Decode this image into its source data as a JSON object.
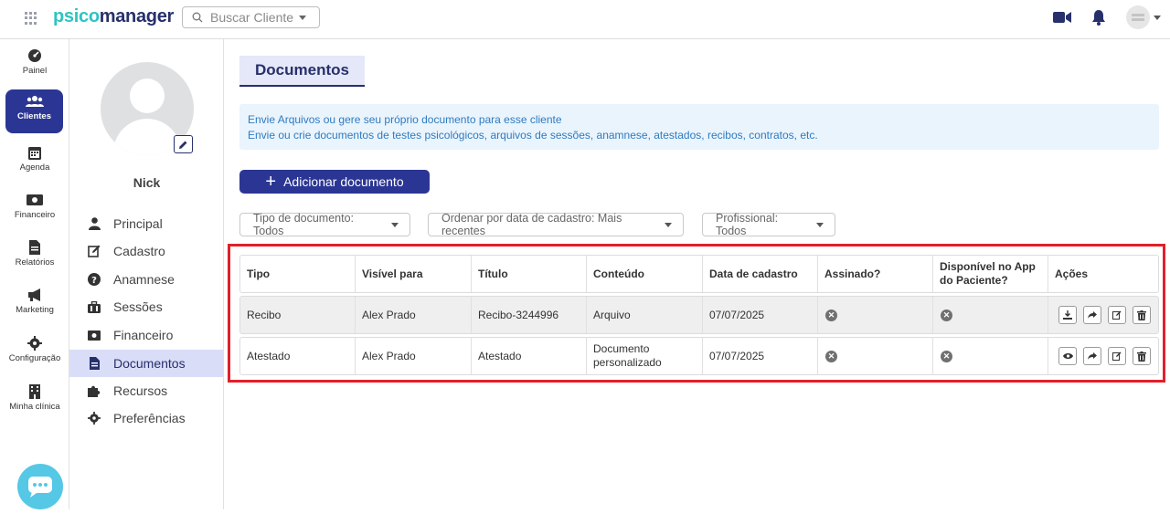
{
  "app": {
    "logo_prefix": "psico",
    "logo_suffix": "manager",
    "search_placeholder": "Buscar Cliente"
  },
  "rail": {
    "items": [
      {
        "label": "Painel",
        "icon": "dashboard-icon"
      },
      {
        "label": "Clientes",
        "icon": "users-icon",
        "active": true
      },
      {
        "label": "Agenda",
        "icon": "calendar-icon"
      },
      {
        "label": "Financeiro",
        "icon": "money-icon"
      },
      {
        "label": "Relatórios",
        "icon": "report-icon"
      },
      {
        "label": "Marketing",
        "icon": "megaphone-icon"
      },
      {
        "label": "Configuração",
        "icon": "gear-icon"
      },
      {
        "label": "Minha clínica",
        "icon": "building-icon"
      }
    ]
  },
  "profile": {
    "name": "Nick",
    "menu": [
      {
        "label": "Principal",
        "icon": "user-icon"
      },
      {
        "label": "Cadastro",
        "icon": "edit-icon"
      },
      {
        "label": "Anamnese",
        "icon": "question-icon"
      },
      {
        "label": "Sessões",
        "icon": "briefcase-icon"
      },
      {
        "label": "Financeiro",
        "icon": "money-icon"
      },
      {
        "label": "Documentos",
        "icon": "file-icon",
        "active": true
      },
      {
        "label": "Recursos",
        "icon": "puzzle-icon"
      },
      {
        "label": "Preferências",
        "icon": "gear-icon"
      }
    ]
  },
  "main": {
    "tab_title": "Documentos",
    "info_line1": "Envie Arquivos ou gere seu próprio documento para esse cliente",
    "info_line2": "Envie ou crie documentos de testes psicológicos, arquivos de sessões, anamnese, atestados, recibos, contratos, etc.",
    "add_button": "Adicionar documento",
    "filters": [
      "Tipo de documento: Todos",
      "Ordenar por data de cadastro: Mais recentes",
      "Profissional: Todos"
    ],
    "table": {
      "headers": [
        "Tipo",
        "Visível para",
        "Título",
        "Conteúdo",
        "Data de cadastro",
        "Assinado?",
        "Disponível no App do Paciente?",
        "Ações"
      ],
      "rows": [
        {
          "tipo": "Recibo",
          "visivel": "Alex Prado",
          "titulo": "Recibo-3244996",
          "conteudo": "Arquivo",
          "data": "07/07/2025"
        },
        {
          "tipo": "Atestado",
          "visivel": "Alex Prado",
          "titulo": "Atestado",
          "conteudo": "Documento personalizado",
          "data": "07/07/2025"
        }
      ]
    }
  },
  "colors": {
    "primary": "#2b3694",
    "accent": "#2ec4c4",
    "info": "#2f7bbf",
    "highlight": "#e0202a"
  }
}
